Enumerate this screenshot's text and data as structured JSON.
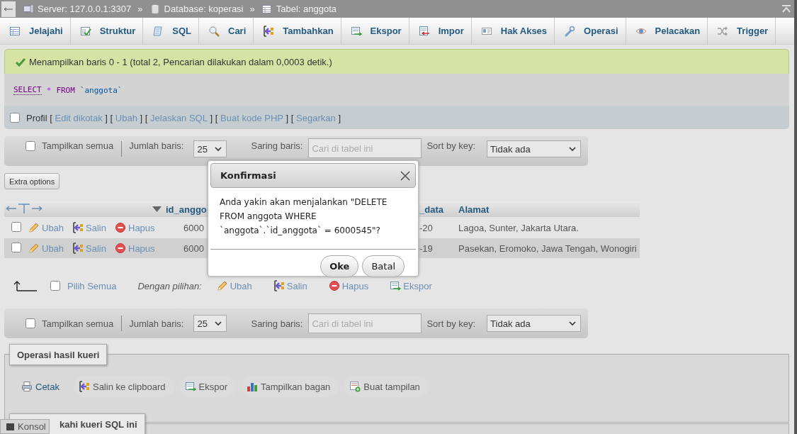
{
  "breadcrumb_separator": "»",
  "breadcrumb": [
    {
      "label": "Server: 127.0.0.1:3307"
    },
    {
      "label": "Database: koperasi"
    },
    {
      "label": "Tabel: anggota"
    }
  ],
  "tabs": [
    {
      "label": "Jelajahi",
      "selected": false
    },
    {
      "label": "Struktur",
      "selected": false
    },
    {
      "label": "SQL",
      "selected": false
    },
    {
      "label": "Cari",
      "selected": false
    },
    {
      "label": "Tambahkan",
      "selected": false
    },
    {
      "label": "Ekspor",
      "selected": false
    },
    {
      "label": "Impor",
      "selected": false
    },
    {
      "label": "Hak Akses",
      "selected": false
    },
    {
      "label": "Operasi",
      "selected": false
    },
    {
      "label": "Pelacakan",
      "selected": false
    },
    {
      "label": "Trigger",
      "selected": false
    }
  ],
  "message": "Menampilkan baris 0 - 1 (total 2, Pencarian dilakukan dalam 0,0003 detik.)",
  "sql": [
    {
      "text": "SELECT",
      "kind": "keyword"
    },
    {
      "text": "*",
      "kind": "operator"
    },
    {
      "text": "FROM",
      "kind": "keyword"
    },
    {
      "text": "`anggota`",
      "kind": "identifier"
    }
  ],
  "query_links": {
    "profil": {
      "label": "Profil",
      "checked": false
    },
    "open": "[",
    "close": "]",
    "links": [
      "Edit dikotak",
      "Ubah",
      "Jelaskan SQL",
      "Buat kode PHP",
      "Segarkan"
    ]
  },
  "nav_top": {
    "show_all": {
      "label": "Tampilkan semua",
      "checked": false
    },
    "rows_label": "Jumlah baris:",
    "rows_value": "25",
    "filter_label": "Saring baris:",
    "filter_placeholder": "Cari di tabel ini",
    "sort_label": "Sort by key:",
    "sort_value": "Tidak ada"
  },
  "extra_options": "Extra options",
  "table": {
    "columns": [
      {
        "label": "id_anggo",
        "sorted": true
      },
      {
        "label": "_data",
        "sorted": false
      },
      {
        "label": "Alamat",
        "sorted": false
      }
    ],
    "rows": [
      {
        "checked": false,
        "actions": [
          "Ubah",
          "Salin",
          "Hapus"
        ],
        "cells": [
          "6000",
          "-20",
          "Lagoa, Sunter, Jakarta Utara."
        ]
      },
      {
        "checked": false,
        "actions": [
          "Ubah",
          "Salin",
          "Hapus"
        ],
        "cells": [
          "6000",
          "-19",
          "Pasekan, Eromoko, Jawa Tengah, Wonogiri"
        ]
      }
    ]
  },
  "bulk": {
    "select_all": {
      "label": "Pilih Semua",
      "checked": false
    },
    "with_selected": "Dengan pilihan:",
    "actions": [
      "Ubah",
      "Salin",
      "Hapus",
      "Ekspor"
    ]
  },
  "nav_bottom": {
    "show_all": {
      "label": "Tampilkan semua",
      "checked": false
    },
    "rows_label": "Jumlah baris:",
    "rows_value": "25",
    "filter_label": "Saring baris:",
    "filter_placeholder": "Cari di tabel ini",
    "sort_label": "Sort by key:",
    "sort_value": "Tidak ada"
  },
  "query_results_operations": {
    "legend": "Operasi hasil kueri",
    "actions": [
      "Cetak",
      "Salin ke clipboard",
      "Ekspor",
      "Tampilkan bagan",
      "Buat tampilan"
    ]
  },
  "bookmark": {
    "legend": "kahi kueri SQL ini"
  },
  "console": {
    "label": "Konsol"
  },
  "dialog": {
    "title": "Konfirmasi",
    "message": "Anda yakin akan menjalankan \"DELETE FROM anggota WHERE `anggota`.`id_anggota` = 6000545\"?",
    "buttons": [
      {
        "label": "Oke",
        "kind": "primary"
      },
      {
        "label": "Batal",
        "kind": "secondary"
      }
    ]
  }
}
